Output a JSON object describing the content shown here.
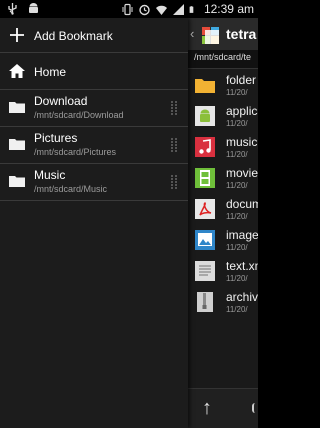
{
  "status_bar": {
    "time": "12:39 am",
    "left_icons": [
      "usb-icon",
      "android-icon"
    ],
    "right_icons": [
      "vibrate-icon",
      "alarm-icon",
      "wifi-icon",
      "signal-icon",
      "battery-icon"
    ]
  },
  "drawer": {
    "add_bookmark": "Add Bookmark",
    "home": "Home",
    "bookmarks": [
      {
        "label": "Download",
        "path": "/mnt/sdcard/Download"
      },
      {
        "label": "Pictures",
        "path": "/mnt/sdcard/Pictures"
      },
      {
        "label": "Music",
        "path": "/mnt/sdcard/Music"
      }
    ]
  },
  "file_panel": {
    "title": "tetra",
    "path": "/mnt/sdcard/te",
    "files": [
      {
        "name": "folder",
        "date": "11/20/",
        "icon": "folder-icon",
        "color": "#f2b233"
      },
      {
        "name": "applica",
        "date": "11/20/",
        "icon": "android-app-icon",
        "color": "#8bbf3a"
      },
      {
        "name": "music.",
        "date": "11/20/",
        "icon": "music-file-icon",
        "color": "#d9303f"
      },
      {
        "name": "movie.",
        "date": "11/20/",
        "icon": "movie-file-icon",
        "color": "#6fbf3a"
      },
      {
        "name": "docum",
        "date": "11/20/",
        "icon": "pdf-file-icon",
        "color": "#e8e8e8"
      },
      {
        "name": "image.",
        "date": "11/20/",
        "icon": "image-file-icon",
        "color": "#2f86c9"
      },
      {
        "name": "text.xm",
        "date": "11/20/",
        "icon": "text-file-icon",
        "color": "#dcdcdc"
      },
      {
        "name": "archive",
        "date": "11/20/",
        "icon": "archive-file-icon",
        "color": "#cfcfcf"
      }
    ]
  }
}
